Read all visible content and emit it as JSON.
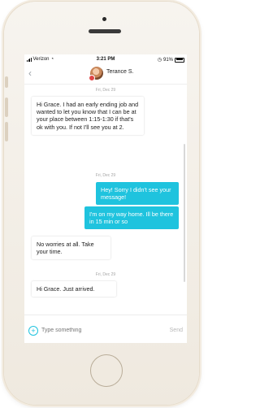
{
  "status_bar": {
    "carrier": "Verizon",
    "time": "3:21 PM",
    "battery": "91%"
  },
  "header": {
    "back_icon": "chevron-left",
    "contact_name": "Terance S."
  },
  "messages": [
    {
      "date": "Fri, Dec 29",
      "direction": "incoming",
      "text": "Hi Grace. I had an early ending job and wanted to let you know that I can be at your place between 1:15-1:30 if that's ok with you. If not I'll see you at 2."
    },
    {
      "date": "Fri, Dec 29",
      "direction": "outgoing",
      "text": "Hey! Sorry I didn't see your message!"
    },
    {
      "date": "",
      "direction": "outgoing",
      "text": "I'm on my way home. Ill be there in 15 min or so"
    },
    {
      "date": "",
      "direction": "incoming",
      "text": "No worries at all. Take your time."
    },
    {
      "date": "Fri, Dec 29",
      "direction": "incoming",
      "text": "Hi Grace. Just arrived."
    }
  ],
  "composer": {
    "placeholder": "Type something",
    "send_label": "Send",
    "add_icon": "plus-circle"
  },
  "colors": {
    "accent": "#1fc3de",
    "incoming_bubble": "#ffffff",
    "date_text": "#a6a6a6"
  }
}
